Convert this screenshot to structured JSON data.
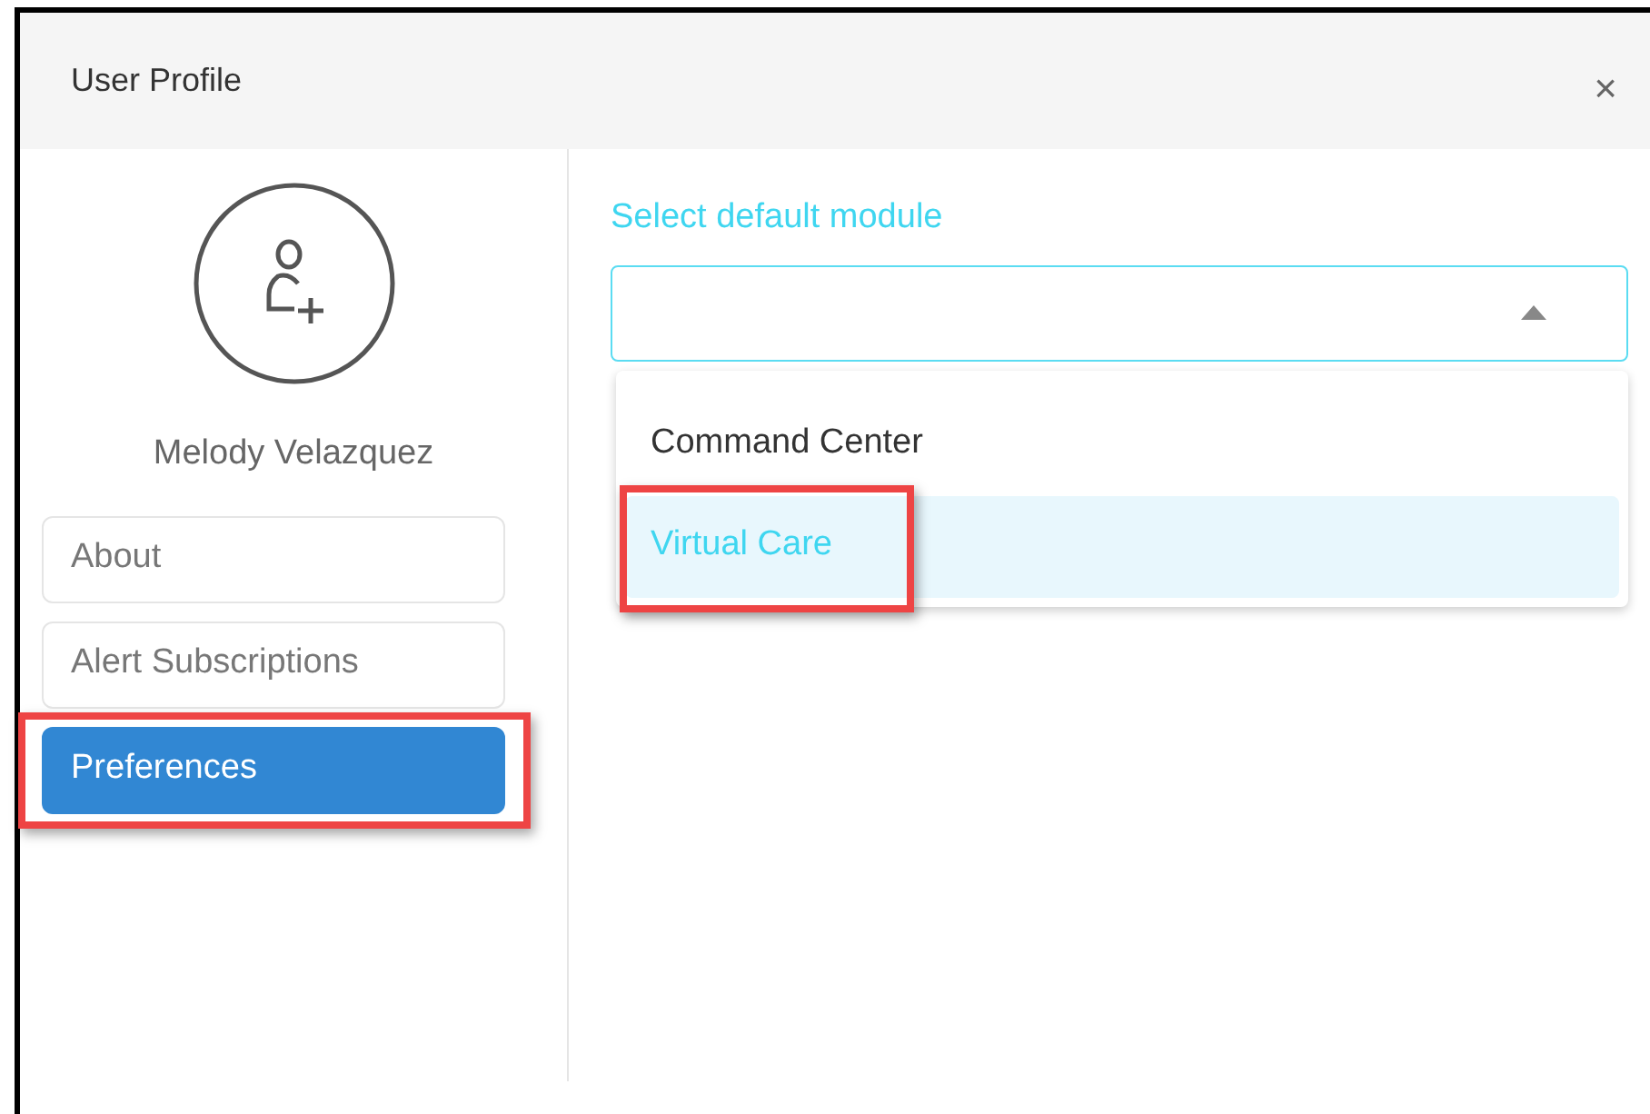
{
  "window": {
    "title": "User Profile",
    "close": "×"
  },
  "profile": {
    "name": "Melody Velazquez"
  },
  "menu": [
    {
      "label": "About",
      "selected": false,
      "highlighted": false
    },
    {
      "label": "Alert Subscriptions",
      "selected": false,
      "highlighted": false
    },
    {
      "label": "Preferences",
      "selected": true,
      "highlighted": true
    }
  ],
  "module_select": {
    "label": "Select default module",
    "expanded": true,
    "options": [
      {
        "label": "Command Center",
        "selected": false,
        "highlighted": false
      },
      {
        "label": "Virtual Care",
        "selected": true,
        "highlighted": true
      }
    ]
  }
}
